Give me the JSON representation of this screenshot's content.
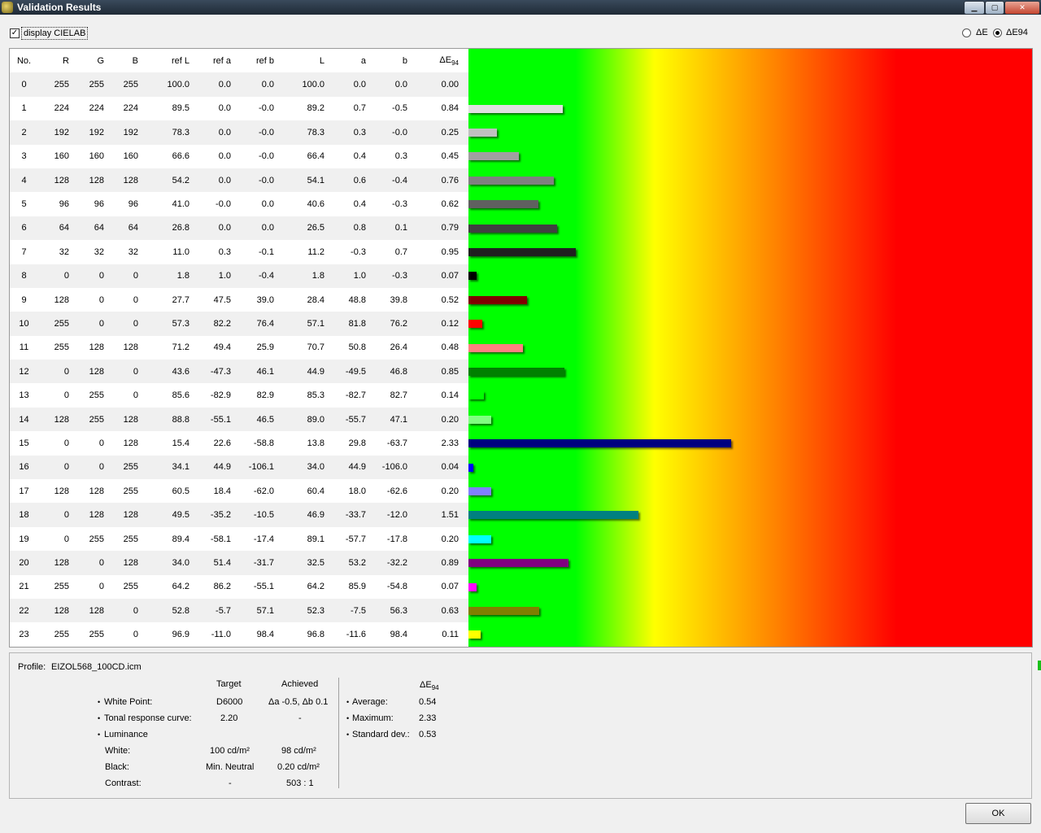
{
  "window": {
    "title": "Validation Results",
    "minimize": "▁",
    "maximize": "▢",
    "close": "✕"
  },
  "options": {
    "display_cielab_label": "display CIELAB",
    "display_cielab_checked": true,
    "radio_de_label": "ΔE",
    "radio_de94_label": "ΔE94",
    "selected": "ΔE94"
  },
  "table": {
    "headers": [
      "No.",
      "R",
      "G",
      "B",
      "ref L",
      "ref a",
      "ref b",
      "L",
      "a",
      "b",
      "ΔE",
      "94"
    ],
    "rows": [
      [
        "0",
        "255",
        "255",
        "255",
        "100.0",
        "0.0",
        "0.0",
        "100.0",
        "0.0",
        "0.0",
        "0.00"
      ],
      [
        "1",
        "224",
        "224",
        "224",
        "89.5",
        "0.0",
        "-0.0",
        "89.2",
        "0.7",
        "-0.5",
        "0.84"
      ],
      [
        "2",
        "192",
        "192",
        "192",
        "78.3",
        "0.0",
        "-0.0",
        "78.3",
        "0.3",
        "-0.0",
        "0.25"
      ],
      [
        "3",
        "160",
        "160",
        "160",
        "66.6",
        "0.0",
        "-0.0",
        "66.4",
        "0.4",
        "0.3",
        "0.45"
      ],
      [
        "4",
        "128",
        "128",
        "128",
        "54.2",
        "0.0",
        "-0.0",
        "54.1",
        "0.6",
        "-0.4",
        "0.76"
      ],
      [
        "5",
        "96",
        "96",
        "96",
        "41.0",
        "-0.0",
        "0.0",
        "40.6",
        "0.4",
        "-0.3",
        "0.62"
      ],
      [
        "6",
        "64",
        "64",
        "64",
        "26.8",
        "0.0",
        "0.0",
        "26.5",
        "0.8",
        "0.1",
        "0.79"
      ],
      [
        "7",
        "32",
        "32",
        "32",
        "11.0",
        "0.3",
        "-0.1",
        "11.2",
        "-0.3",
        "0.7",
        "0.95"
      ],
      [
        "8",
        "0",
        "0",
        "0",
        "1.8",
        "1.0",
        "-0.4",
        "1.8",
        "1.0",
        "-0.3",
        "0.07"
      ],
      [
        "9",
        "128",
        "0",
        "0",
        "27.7",
        "47.5",
        "39.0",
        "28.4",
        "48.8",
        "39.8",
        "0.52"
      ],
      [
        "10",
        "255",
        "0",
        "0",
        "57.3",
        "82.2",
        "76.4",
        "57.1",
        "81.8",
        "76.2",
        "0.12"
      ],
      [
        "11",
        "255",
        "128",
        "128",
        "71.2",
        "49.4",
        "25.9",
        "70.7",
        "50.8",
        "26.4",
        "0.48"
      ],
      [
        "12",
        "0",
        "128",
        "0",
        "43.6",
        "-47.3",
        "46.1",
        "44.9",
        "-49.5",
        "46.8",
        "0.85"
      ],
      [
        "13",
        "0",
        "255",
        "0",
        "85.6",
        "-82.9",
        "82.9",
        "85.3",
        "-82.7",
        "82.7",
        "0.14"
      ],
      [
        "14",
        "128",
        "255",
        "128",
        "88.8",
        "-55.1",
        "46.5",
        "89.0",
        "-55.7",
        "47.1",
        "0.20"
      ],
      [
        "15",
        "0",
        "0",
        "128",
        "15.4",
        "22.6",
        "-58.8",
        "13.8",
        "29.8",
        "-63.7",
        "2.33"
      ],
      [
        "16",
        "0",
        "0",
        "255",
        "34.1",
        "44.9",
        "-106.1",
        "34.0",
        "44.9",
        "-106.0",
        "0.04"
      ],
      [
        "17",
        "128",
        "128",
        "255",
        "60.5",
        "18.4",
        "-62.0",
        "60.4",
        "18.0",
        "-62.6",
        "0.20"
      ],
      [
        "18",
        "0",
        "128",
        "128",
        "49.5",
        "-35.2",
        "-10.5",
        "46.9",
        "-33.7",
        "-12.0",
        "1.51"
      ],
      [
        "19",
        "0",
        "255",
        "255",
        "89.4",
        "-58.1",
        "-17.4",
        "89.1",
        "-57.7",
        "-17.8",
        "0.20"
      ],
      [
        "20",
        "128",
        "0",
        "128",
        "34.0",
        "51.4",
        "-31.7",
        "32.5",
        "53.2",
        "-32.2",
        "0.89"
      ],
      [
        "21",
        "255",
        "0",
        "255",
        "64.2",
        "86.2",
        "-55.1",
        "64.2",
        "85.9",
        "-54.8",
        "0.07"
      ],
      [
        "22",
        "128",
        "128",
        "0",
        "52.8",
        "-5.7",
        "57.1",
        "52.3",
        "-7.5",
        "56.3",
        "0.63"
      ],
      [
        "23",
        "255",
        "255",
        "0",
        "96.9",
        "-11.0",
        "98.4",
        "96.8",
        "-11.6",
        "98.4",
        "0.11"
      ]
    ],
    "bar_scale_max": 5.0
  },
  "colors": {
    "gradient_green": "#00ff00",
    "gradient_yellow": "#ffff00",
    "gradient_red": "#ff0000"
  },
  "summary": {
    "profile_label": "Profile:",
    "profile_value": "EIZOL568_100CD.icm",
    "target_header": "Target",
    "achieved_header": "Achieved",
    "white_point_label": "White Point:",
    "white_point_target": "D6000",
    "white_point_achieved": "Δa -0.5, Δb 0.1",
    "trc_label": "Tonal response curve:",
    "trc_target": "2.20",
    "trc_achieved": "-",
    "luminance_label": "Luminance",
    "white_label": "White:",
    "white_target": "100 cd/m²",
    "white_achieved": "98 cd/m²",
    "black_label": "Black:",
    "black_target": "Min. Neutral",
    "black_achieved": "0.20 cd/m²",
    "contrast_label": "Contrast:",
    "contrast_target": "-",
    "contrast_achieved": "503 : 1",
    "de_header": "ΔE",
    "de_header_sub": "94",
    "average_label": "Average:",
    "average_value": "0.54",
    "maximum_label": "Maximum:",
    "maximum_value": "2.33",
    "stddev_label": "Standard dev.:",
    "stddev_value": "0.53",
    "bullet": "•"
  },
  "buttons": {
    "ok": "OK"
  }
}
